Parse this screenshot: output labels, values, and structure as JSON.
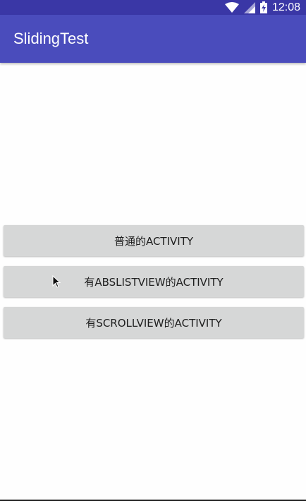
{
  "status_bar": {
    "time": "12:08",
    "icons": [
      "wifi-icon",
      "cell-signal-icon",
      "battery-charging-icon"
    ],
    "color": "#3a37a6"
  },
  "app_bar": {
    "title": "SlidingTest",
    "color": "#4a4cbc"
  },
  "buttons": [
    {
      "label": "普通的ACTIVITY"
    },
    {
      "label": "有ABSLISTVIEW的ACTIVITY"
    },
    {
      "label": "有SCROLLVIEW的ACTIVITY"
    }
  ],
  "colors": {
    "button_bg": "#d6d7d7",
    "background": "#fefefe"
  }
}
